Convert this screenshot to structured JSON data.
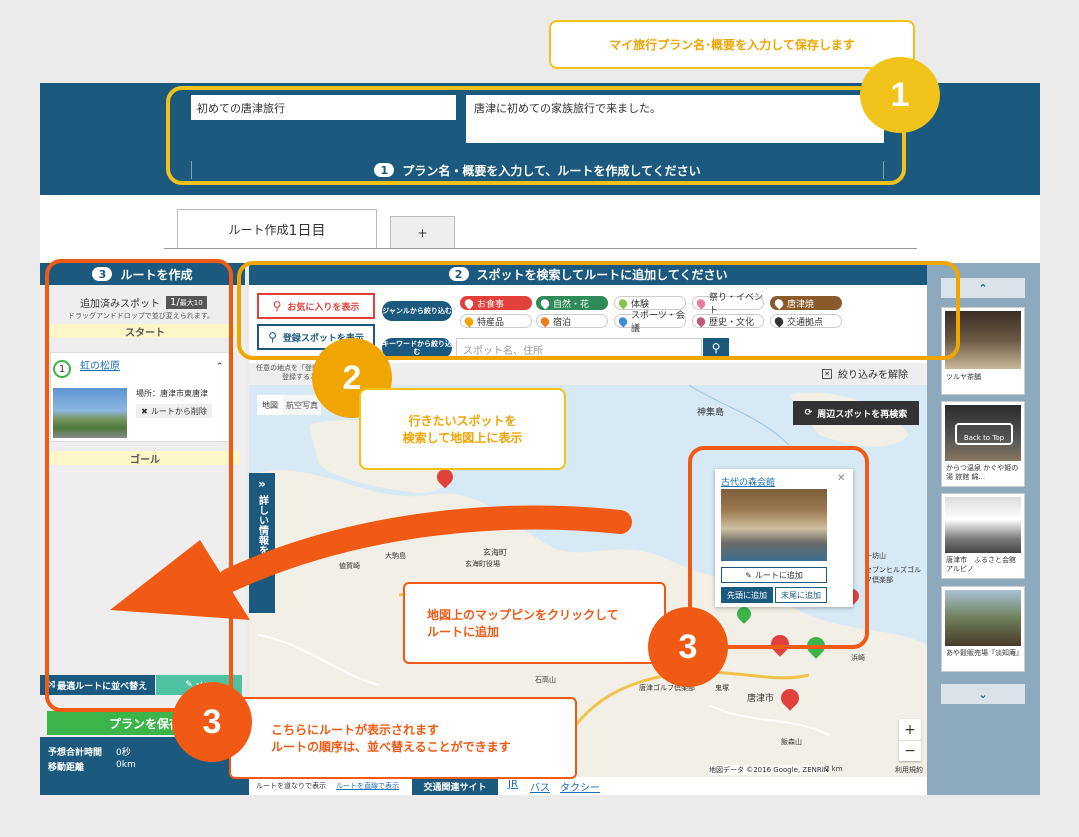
{
  "callouts": {
    "c1": "マイ旅行プラン名･概要を入力して保存します",
    "c2_line1": "行きたいスポットを",
    "c2_line2": "検索して地図上に表示",
    "c3_line1": "地図上のマップピンをクリックして",
    "c3_line2": "ルートに追加",
    "c4_line1": "こちらにルートが表示されます",
    "c4_line2": "ルートの順序は、並べ替えることができます"
  },
  "badges": {
    "one": "1",
    "two": "2",
    "three": "3"
  },
  "plan": {
    "name_value": "初めての唐津旅行",
    "summary_value": "唐津に初めての家族旅行で来ました。",
    "instruction_num": "1",
    "instruction": "プラン名・概要を入力して、ルートを作成してください"
  },
  "tabs": [
    {
      "label_prefix": "ルート作成",
      "label_day": "1日目"
    },
    {
      "label": "+"
    }
  ],
  "route": {
    "head_num": "3",
    "head": "ルートを作成",
    "added_label": "追加済みスポット",
    "count": "1/",
    "max": "最大10",
    "drag_hint": "ドラッグアンドドロップで並び変えられます。",
    "start": "スタート",
    "spot_num": "1",
    "spot_name": "虹の松原",
    "spot_place": "場所：唐津市東唐津",
    "remove": "ルートから削除",
    "goal": "ゴール",
    "optimize": "最適ルートに並べ替え",
    "memo": "メモ",
    "create": "プランを保存",
    "total_time_label": "予想合計時間",
    "total_time": "0秒",
    "distance_label": "移動距離",
    "distance": "0km"
  },
  "search": {
    "head_num": "2",
    "head": "スポットを検索してルートに追加してください",
    "favorites": "お気に入りを表示",
    "registered": "登録スポットを表示",
    "genre_btn": "ジャンルから絞り込む",
    "keyword_btn": "キーワードから絞り込む",
    "placeholder": "スポット名、住所",
    "genres": [
      "お食事",
      "自然・花",
      "体験",
      "祭り・イベント",
      "唐津焼",
      "特産品",
      "宿泊",
      "スポーツ・会議",
      "歴史・文化",
      "交通拠点"
    ],
    "hint": "任意の地点を「登録」",
    "hint2": "登録すると",
    "clear_filter": "絞り込みを解除"
  },
  "map": {
    "type_map": "地図",
    "type_sat": "航空写真",
    "research": "周辺スポットを再検索",
    "side_tab": "詳しい情報を表示",
    "popup_title": "古代の森会館",
    "popup_add": "ルートに追加",
    "popup_first": "先頭に追加",
    "popup_last": "末尾に追加",
    "labels": [
      "神集島",
      "玄海町",
      "玄海町役場",
      "大駒島",
      "値賀崎",
      "十坊山",
      "石高山",
      "唐津ゴルフ倶楽部",
      "唐津市",
      "鬼塚",
      "飯森山",
      "浜崎",
      "セブンヒルズゴルフ倶楽部"
    ],
    "copyright": "地図データ ©2016 Google, ZENRIN",
    "scale": "2 km",
    "terms": "利用規約",
    "zoom_in": "+",
    "zoom_out": "−"
  },
  "footer": {
    "route_note": "ルートを道なりで表示",
    "route_link": "ルートを直線で表示",
    "traffic": "交通関連サイト",
    "links": [
      "JR",
      "バス",
      "タクシー"
    ]
  },
  "sidebar": {
    "thumbs": [
      {
        "caption": "ツルヤ茶舗"
      },
      {
        "caption": "からつ温泉 かぐや姫の湯 旅館 綿...",
        "overlay": "Back to Top"
      },
      {
        "caption": "唐津市　ふるさと会館　アルピノ"
      },
      {
        "caption": "あや穀販売場『淡知庵』"
      }
    ]
  }
}
